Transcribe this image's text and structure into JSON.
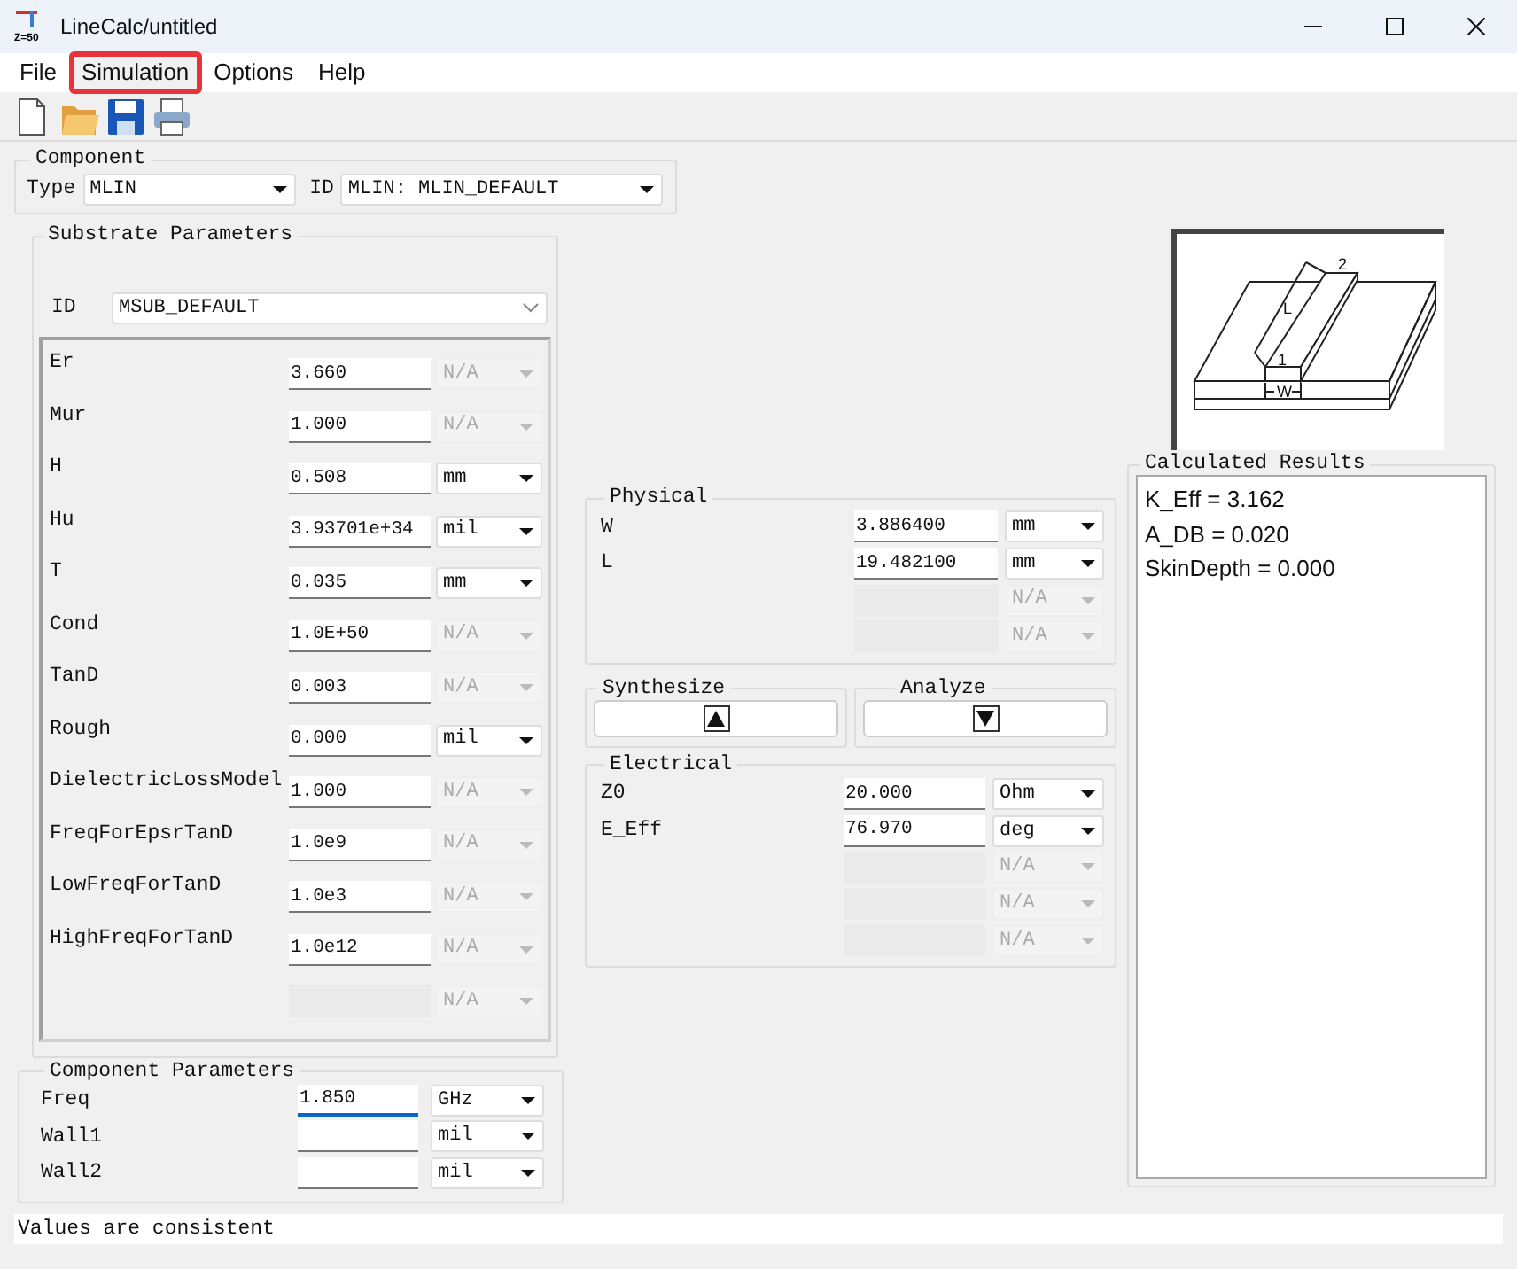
{
  "window": {
    "title": "LineCalc/untitled",
    "icon_text": "Z=50"
  },
  "menu": [
    {
      "label": "File",
      "highlighted": false
    },
    {
      "label": "Simulation",
      "highlighted": true
    },
    {
      "label": "Options",
      "highlighted": false
    },
    {
      "label": "Help",
      "highlighted": false
    }
  ],
  "toolbar": [
    {
      "kind": "new"
    },
    {
      "kind": "open"
    },
    {
      "kind": "save"
    },
    {
      "kind": "print"
    }
  ],
  "component": {
    "title": "Component",
    "type_label": "Type",
    "type_value": "MLIN",
    "id_label": "ID",
    "id_value": "MLIN: MLIN_DEFAULT"
  },
  "substrate": {
    "title": "Substrate Parameters",
    "id_label": "ID",
    "id_value": "MSUB_DEFAULT",
    "rows": [
      {
        "name": "Er",
        "value": "3.660",
        "unit": "N/A",
        "unit_disabled": true,
        "field_disabled": false
      },
      {
        "name": "Mur",
        "value": "1.000",
        "unit": "N/A",
        "unit_disabled": true,
        "field_disabled": false
      },
      {
        "name": "H",
        "value": "0.508",
        "unit": "mm",
        "unit_disabled": false,
        "field_disabled": false
      },
      {
        "name": "Hu",
        "value": "3.93701e+34",
        "unit": "mil",
        "unit_disabled": false,
        "field_disabled": false
      },
      {
        "name": "T",
        "value": "0.035",
        "unit": "mm",
        "unit_disabled": false,
        "field_disabled": false
      },
      {
        "name": "Cond",
        "value": "1.0E+50",
        "unit": "N/A",
        "unit_disabled": true,
        "field_disabled": false
      },
      {
        "name": "TanD",
        "value": "0.003",
        "unit": "N/A",
        "unit_disabled": true,
        "field_disabled": false
      },
      {
        "name": "Rough",
        "value": "0.000",
        "unit": "mil",
        "unit_disabled": false,
        "field_disabled": false
      },
      {
        "name": "DielectricLossModel",
        "value": "1.000",
        "unit": "N/A",
        "unit_disabled": true,
        "field_disabled": false
      },
      {
        "name": "FreqForEpsrTanD",
        "value": "1.0e9",
        "unit": "N/A",
        "unit_disabled": true,
        "field_disabled": false
      },
      {
        "name": "LowFreqForTanD",
        "value": "1.0e3",
        "unit": "N/A",
        "unit_disabled": true,
        "field_disabled": false
      },
      {
        "name": "HighFreqForTanD",
        "value": "1.0e12",
        "unit": "N/A",
        "unit_disabled": true,
        "field_disabled": false
      },
      {
        "unit": "N/A",
        "unit_disabled": true,
        "field_disabled": true
      }
    ]
  },
  "component_parameters": {
    "title": "Component Parameters",
    "rows": [
      {
        "name": "Freq",
        "value": "1.850",
        "unit": "GHz",
        "unit_disabled": false,
        "field_disabled": false,
        "focused": true
      },
      {
        "name": "Wall1",
        "unit": "mil",
        "unit_disabled": false,
        "field_disabled": false,
        "focused": false
      },
      {
        "name": "Wall2",
        "unit": "mil",
        "unit_disabled": false,
        "field_disabled": false,
        "focused": false
      }
    ]
  },
  "physical": {
    "title": "Physical",
    "rows": [
      {
        "name": "W",
        "value": "3.886400",
        "unit": "mm",
        "unit_disabled": false,
        "field_disabled": false
      },
      {
        "name": "L",
        "value": "19.482100",
        "unit": "mm",
        "unit_disabled": false,
        "field_disabled": false
      },
      {
        "unit": "N/A",
        "unit_disabled": true,
        "field_disabled": true
      },
      {
        "unit": "N/A",
        "unit_disabled": true,
        "field_disabled": true
      }
    ]
  },
  "synthesize": {
    "title": "Synthesize",
    "kind": "up"
  },
  "analyze": {
    "title": "Analyze",
    "kind": "down"
  },
  "electrical": {
    "title": "Electrical",
    "rows": [
      {
        "name": "Z0",
        "value": "20.000",
        "unit": "Ohm",
        "unit_disabled": false,
        "field_disabled": false
      },
      {
        "name": "E_Eff",
        "value": "76.970",
        "unit": "deg",
        "unit_disabled": false,
        "field_disabled": false
      },
      {
        "unit": "N/A",
        "unit_disabled": true,
        "field_disabled": true
      },
      {
        "unit": "N/A",
        "unit_disabled": true,
        "field_disabled": true
      },
      {
        "unit": "N/A",
        "unit_disabled": true,
        "field_disabled": true
      }
    ]
  },
  "diagram": {
    "labels": [
      "L",
      "2",
      "1",
      "W"
    ]
  },
  "results": {
    "title": "Calculated Results",
    "lines": [
      "K_Eff = 3.162",
      "A_DB = 0.020",
      "SkinDepth = 0.000"
    ]
  },
  "status_bar": "Values are consistent"
}
